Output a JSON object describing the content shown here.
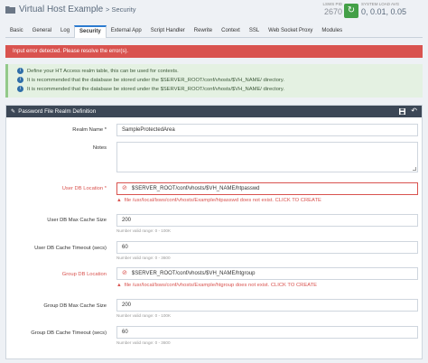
{
  "header": {
    "title": "Virtual Host Example",
    "subtitle": "> Security",
    "pid_label": "LSWS PID",
    "pid_value": "2670",
    "restart_icon": "refresh-icon",
    "load_label": "SYSTEM LOAD AVG",
    "load_value": "0, 0.01, 0.05"
  },
  "tabs": [
    "Basic",
    "General",
    "Log",
    "Security",
    "External App",
    "Script Handler",
    "Rewrite",
    "Context",
    "SSL",
    "Web Socket Proxy",
    "Modules"
  ],
  "alerts": {
    "error": "Input error detected. Please resolve the error(s).",
    "info": [
      "Define your HT Access realm table, this can be used for contexts.",
      "It is recommended that the database be stored under the $SERVER_ROOT/conf/vhosts/$VH_NAME/ directory.",
      "It is recommended that the database be stored under the $SERVER_ROOT/conf/vhosts/$VH_NAME/ directory."
    ]
  },
  "panel": {
    "title": "Password File Realm Definition",
    "fields": {
      "realm_name": {
        "label": "Realm Name *",
        "value": "SampleProtectedArea"
      },
      "notes": {
        "label": "Notes",
        "value": ""
      },
      "user_db_location": {
        "label": "User DB Location *",
        "value": "$SERVER_ROOT/conf/vhosts/$VH_NAME/htpasswd",
        "error": "file /usr/local/lsws/conf/vhosts/Example/htpasswd does not exist. CLICK TO CREATE"
      },
      "user_db_max_cache_size": {
        "label": "User DB Max Cache Size",
        "value": "200",
        "hint": "Number valid range: 0 - 100K"
      },
      "user_db_cache_timeout": {
        "label": "User DB Cache Timeout (secs)",
        "value": "60",
        "hint": "Number valid range: 0 - 3600"
      },
      "group_db_location": {
        "label": "Group DB Location",
        "value": "$SERVER_ROOT/conf/vhosts/$VH_NAME/htgroup",
        "error": "file /usr/local/lsws/conf/vhosts/Example/htgroup does not exist. CLICK TO CREATE"
      },
      "group_db_max_cache_size": {
        "label": "Group DB Max Cache Size",
        "value": "200",
        "hint": "Number valid range: 0 - 100K"
      },
      "group_db_cache_timeout": {
        "label": "Group DB Cache Timeout (secs)",
        "value": "60",
        "hint": "Number valid range: 0 - 3600"
      }
    }
  },
  "colors": {
    "accent": "#2c7bd0",
    "error": "#d9534f",
    "panel_header": "#3c4756",
    "info_bg": "#e4f1e2",
    "restart_green": "#43a047"
  }
}
